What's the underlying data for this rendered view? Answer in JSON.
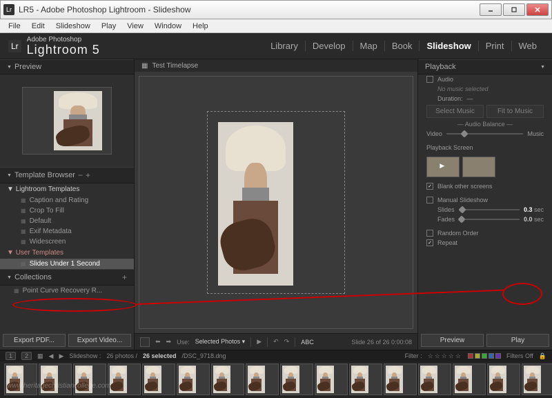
{
  "window": {
    "title": "LR5 - Adobe Photoshop Lightroom - Slideshow"
  },
  "menu": [
    "File",
    "Edit",
    "Slideshow",
    "Play",
    "View",
    "Window",
    "Help"
  ],
  "brand": {
    "line1": "Adobe Photoshop",
    "line2": "Lightroom 5",
    "lr": "Lr"
  },
  "modules": [
    "Library",
    "Develop",
    "Map",
    "Book",
    "Slideshow",
    "Print",
    "Web"
  ],
  "activeModule": "Slideshow",
  "left": {
    "preview": "Preview",
    "templateBrowser": "Template Browser",
    "lrTemplates": "Lightroom Templates",
    "lrItems": [
      "Caption and Rating",
      "Crop To Fill",
      "Default",
      "Exif Metadata",
      "Widescreen"
    ],
    "userTemplates": "User Templates",
    "userItems": [
      "Slides Under 1 Second"
    ],
    "collections": "Collections",
    "collItems": [
      "Point Curve Recovery R..."
    ],
    "btnExportPdf": "Export PDF...",
    "btnExportVideo": "Export Video..."
  },
  "center": {
    "title": "Test Timelapse",
    "use": "Use:",
    "useVal": "Selected Photos",
    "abc": "ABC",
    "slideInfo": "Slide 26 of 26  0:00:08"
  },
  "right": {
    "playback": "Playback",
    "audio": "Audio",
    "noMusic": "No music selected",
    "duration": "Duration:",
    "selectMusic": "Select Music",
    "fitToMusic": "Fit to Music",
    "audioBalance": "Audio Balance",
    "video": "Video",
    "music": "Music",
    "playbackScreen": "Playback Screen",
    "blankScreens": "Blank other screens",
    "manual": "Manual Slideshow",
    "slides": "Slides",
    "slidesVal": "0.3",
    "sec": "sec",
    "fades": "Fades",
    "fadesVal": "0.0",
    "randomOrder": "Random Order",
    "repeat": "Repeat",
    "preview": "Preview",
    "play": "Play"
  },
  "filmstrip": {
    "nums": [
      "1",
      "2"
    ],
    "label": "Slideshow :",
    "count": "26 photos /",
    "selected": "26 selected",
    "file": "/DSC_9718.dng",
    "filter": "Filter :",
    "filtersOff": "Filters Off"
  },
  "watermark": "www.heritagechristiancollege.com"
}
